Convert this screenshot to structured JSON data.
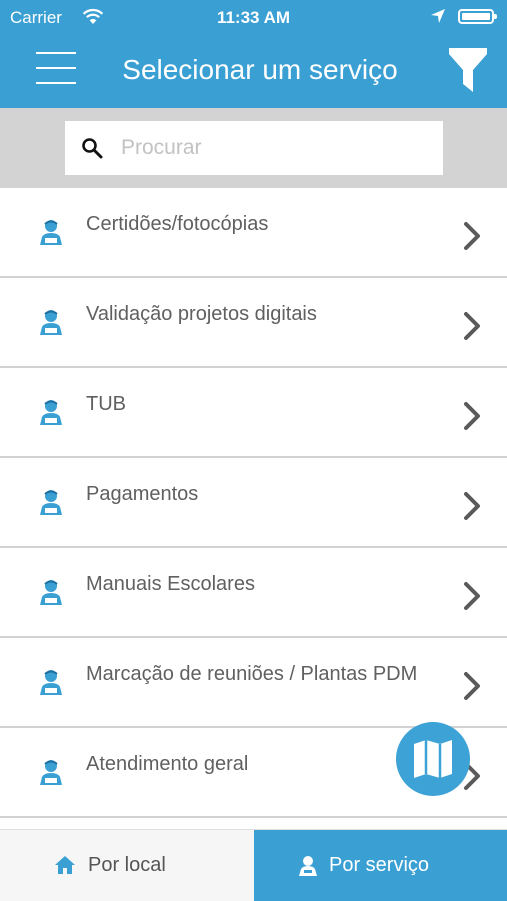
{
  "status_bar": {
    "carrier": "Carrier",
    "time": "11:33 AM",
    "battery_level": 1.0
  },
  "header": {
    "title": "Selecionar um serviço",
    "menu_icon": "menu-icon",
    "filter_icon": "filter-icon"
  },
  "search": {
    "placeholder": "Procurar",
    "value": ""
  },
  "services": [
    {
      "label": "Certidões/fotocópias"
    },
    {
      "label": "Validação projetos digitais"
    },
    {
      "label": "TUB"
    },
    {
      "label": "Pagamentos"
    },
    {
      "label": "Manuais Escolares"
    },
    {
      "label": "Marcação de reuniões / Plantas PDM"
    },
    {
      "label": "Atendimento geral"
    }
  ],
  "fab": {
    "icon": "map-icon"
  },
  "tabs": {
    "local_label": "Por local",
    "service_label": "Por serviço",
    "active": "service"
  },
  "colors": {
    "primary": "#3a9fd3",
    "search_bg": "#d3d3d3",
    "row_text": "#606060",
    "chevron": "#5a5a5a"
  }
}
